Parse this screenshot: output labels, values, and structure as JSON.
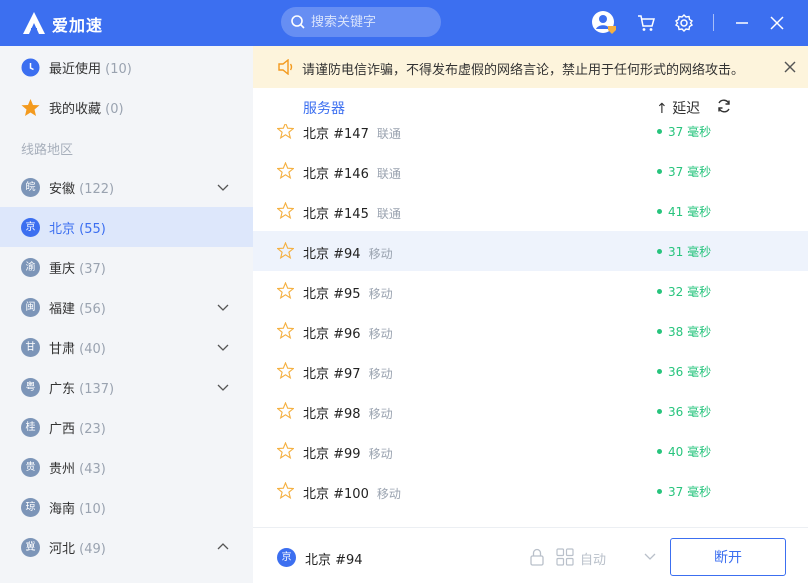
{
  "app": {
    "title": "爱加速",
    "brand_color": "#3c6ff0"
  },
  "search": {
    "placeholder": "搜索关键字"
  },
  "sidebar": {
    "recent": {
      "label": "最近使用",
      "count": "(10)",
      "icon": "clock-icon"
    },
    "favorites": {
      "label": "我的收藏",
      "count": "(0)",
      "icon": "star-icon"
    },
    "section_title": "线路地区",
    "regions": [
      {
        "badge": "皖",
        "label": "安徽",
        "count": "(122)",
        "expandable": true,
        "expanded": false
      },
      {
        "badge": "京",
        "label": "北京",
        "count": "(55)",
        "expandable": false,
        "active": true
      },
      {
        "badge": "渝",
        "label": "重庆",
        "count": "(37)",
        "expandable": false
      },
      {
        "badge": "闽",
        "label": "福建",
        "count": "(56)",
        "expandable": true,
        "expanded": false
      },
      {
        "badge": "甘",
        "label": "甘肃",
        "count": "(40)",
        "expandable": true,
        "expanded": false
      },
      {
        "badge": "粤",
        "label": "广东",
        "count": "(137)",
        "expandable": true,
        "expanded": false
      },
      {
        "badge": "桂",
        "label": "广西",
        "count": "(23)",
        "expandable": false
      },
      {
        "badge": "贵",
        "label": "贵州",
        "count": "(43)",
        "expandable": false
      },
      {
        "badge": "琼",
        "label": "海南",
        "count": "(10)",
        "expandable": false
      },
      {
        "badge": "冀",
        "label": "河北",
        "count": "(49)",
        "expandable": true,
        "expanded": true
      }
    ]
  },
  "notice": {
    "text": "请谨防电信诈骗，不得发布虚假的网络言论，禁止用于任何形式的网络攻击。"
  },
  "list": {
    "col_server": "服务器",
    "col_latency": "延迟",
    "rows": [
      {
        "name": "北京 #147",
        "isp": "联通",
        "latency": "37 毫秒"
      },
      {
        "name": "北京 #146",
        "isp": "联通",
        "latency": "37 毫秒"
      },
      {
        "name": "北京 #145",
        "isp": "联通",
        "latency": "41 毫秒"
      },
      {
        "name": "北京 #94",
        "isp": "移动",
        "latency": "31 毫秒",
        "highlight": true
      },
      {
        "name": "北京 #95",
        "isp": "移动",
        "latency": "32 毫秒"
      },
      {
        "name": "北京 #96",
        "isp": "移动",
        "latency": "38 毫秒"
      },
      {
        "name": "北京 #97",
        "isp": "移动",
        "latency": "36 毫秒"
      },
      {
        "name": "北京 #98",
        "isp": "移动",
        "latency": "36 毫秒"
      },
      {
        "name": "北京 #99",
        "isp": "移动",
        "latency": "40 毫秒"
      },
      {
        "name": "北京 #100",
        "isp": "移动",
        "latency": "37 毫秒"
      }
    ]
  },
  "bottom": {
    "current_badge": "京",
    "current_name": "北京 #94",
    "mode": "自动",
    "disconnect_label": "断开"
  },
  "colors": {
    "latency_good": "#27c47d",
    "star": "#f5b041"
  }
}
